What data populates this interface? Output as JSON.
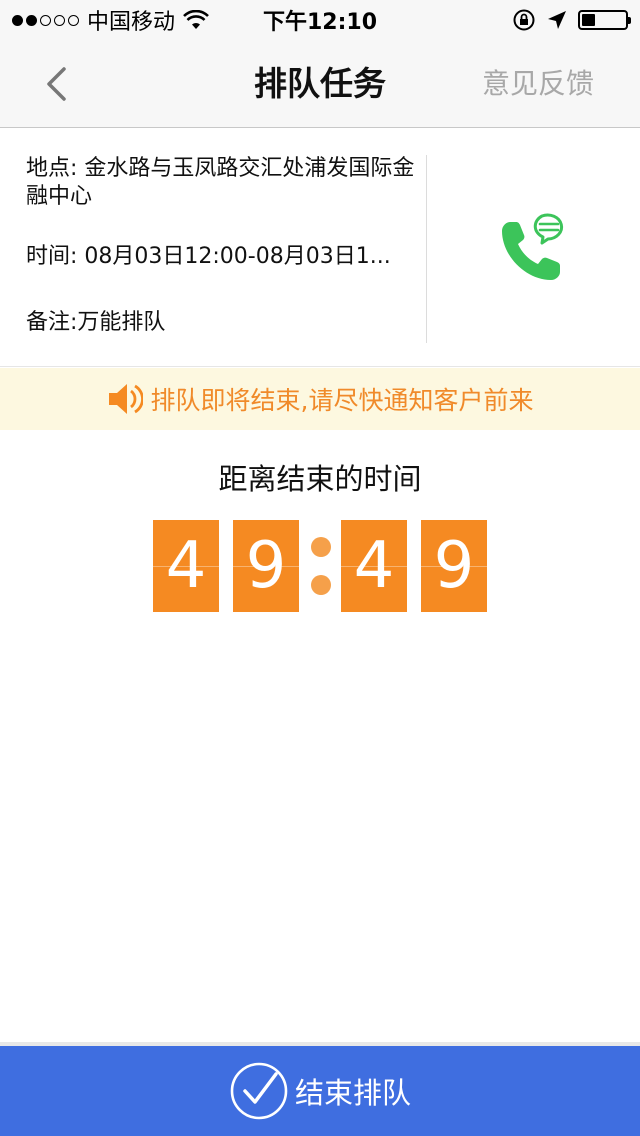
{
  "status_bar": {
    "carrier": "中国移动",
    "time": "下午12:10",
    "signal_bars_filled": 2,
    "signal_bars_total": 5,
    "battery_level": 0.3
  },
  "nav": {
    "title": "排队任务",
    "action_label": "意见反馈"
  },
  "info": {
    "address": "地点: 金水路与玉凤路交汇处浦发国际金融中心",
    "time": "时间: 08月03日12:00-08月03日1...",
    "remark": "备注:万能排队"
  },
  "notice": {
    "text": "排队即将结束,请尽快通知客户前来"
  },
  "countdown": {
    "label": "距离结束的时间",
    "digits": [
      "4",
      "9",
      "4",
      "9"
    ]
  },
  "bottom": {
    "finish_label": "结束排队"
  },
  "colors": {
    "accent_orange": "#f58a22",
    "notice_bg": "#fdf8e0",
    "button_blue": "#3f6ee0",
    "call_green": "#3cc45a"
  },
  "icons": {
    "back": "chevron-left-icon",
    "call": "phone-chat-icon",
    "speaker": "speaker-icon",
    "check": "check-circle-icon"
  }
}
